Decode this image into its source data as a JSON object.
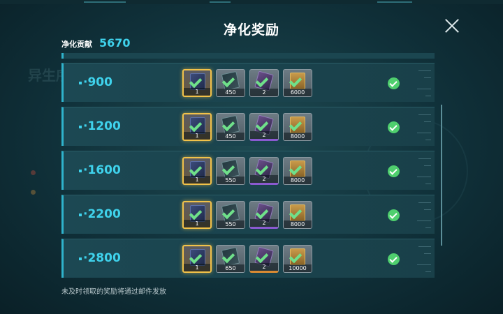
{
  "dialog": {
    "title": "净化奖励",
    "contribution_label": "净化贡献",
    "contribution_value": "5670",
    "footer_note": "未及时领取的奖励将通过邮件发放"
  },
  "background": {
    "faded_text": "异生序"
  },
  "tiers": [
    {
      "threshold": "·900",
      "claimed": true,
      "rewards": [
        {
          "icon": "cube-item-icon",
          "quantity": "1",
          "frame": "gold"
        },
        {
          "icon": "core-item-icon",
          "quantity": "450",
          "frame": "grey"
        },
        {
          "icon": "crystal-item-icon",
          "quantity": "2",
          "frame": "grey"
        },
        {
          "icon": "ticket-item-icon",
          "quantity": "6000",
          "frame": "grey"
        }
      ]
    },
    {
      "threshold": "·1200",
      "claimed": true,
      "rewards": [
        {
          "icon": "cube-item-icon",
          "quantity": "1",
          "frame": "gold"
        },
        {
          "icon": "core-item-icon",
          "quantity": "450",
          "frame": "grey"
        },
        {
          "icon": "crystal-item-icon",
          "quantity": "2",
          "frame": "purple"
        },
        {
          "icon": "ticket-item-icon",
          "quantity": "8000",
          "frame": "grey"
        }
      ]
    },
    {
      "threshold": "·1600",
      "claimed": true,
      "rewards": [
        {
          "icon": "cube-item-icon",
          "quantity": "1",
          "frame": "gold"
        },
        {
          "icon": "core-item-icon",
          "quantity": "550",
          "frame": "grey"
        },
        {
          "icon": "crystal-item-icon",
          "quantity": "2",
          "frame": "purple"
        },
        {
          "icon": "ticket-item-icon",
          "quantity": "8000",
          "frame": "grey"
        }
      ]
    },
    {
      "threshold": "·2200",
      "claimed": true,
      "rewards": [
        {
          "icon": "cube-item-icon",
          "quantity": "1",
          "frame": "gold"
        },
        {
          "icon": "core-item-icon",
          "quantity": "550",
          "frame": "grey"
        },
        {
          "icon": "crystal-item-icon",
          "quantity": "2",
          "frame": "purple"
        },
        {
          "icon": "ticket-item-icon",
          "quantity": "8000",
          "frame": "grey"
        }
      ]
    },
    {
      "threshold": "·2800",
      "claimed": true,
      "rewards": [
        {
          "icon": "cube-item-icon",
          "quantity": "1",
          "frame": "gold"
        },
        {
          "icon": "core-item-icon",
          "quantity": "650",
          "frame": "grey"
        },
        {
          "icon": "crystal-item-icon",
          "quantity": "2",
          "frame": "orange"
        },
        {
          "icon": "ticket-item-icon",
          "quantity": "10000",
          "frame": "grey"
        }
      ]
    }
  ],
  "colors": {
    "accent": "#3fd2ec",
    "claimed_check": "#4fcf6e",
    "gold_frame": "#f2c24a"
  }
}
